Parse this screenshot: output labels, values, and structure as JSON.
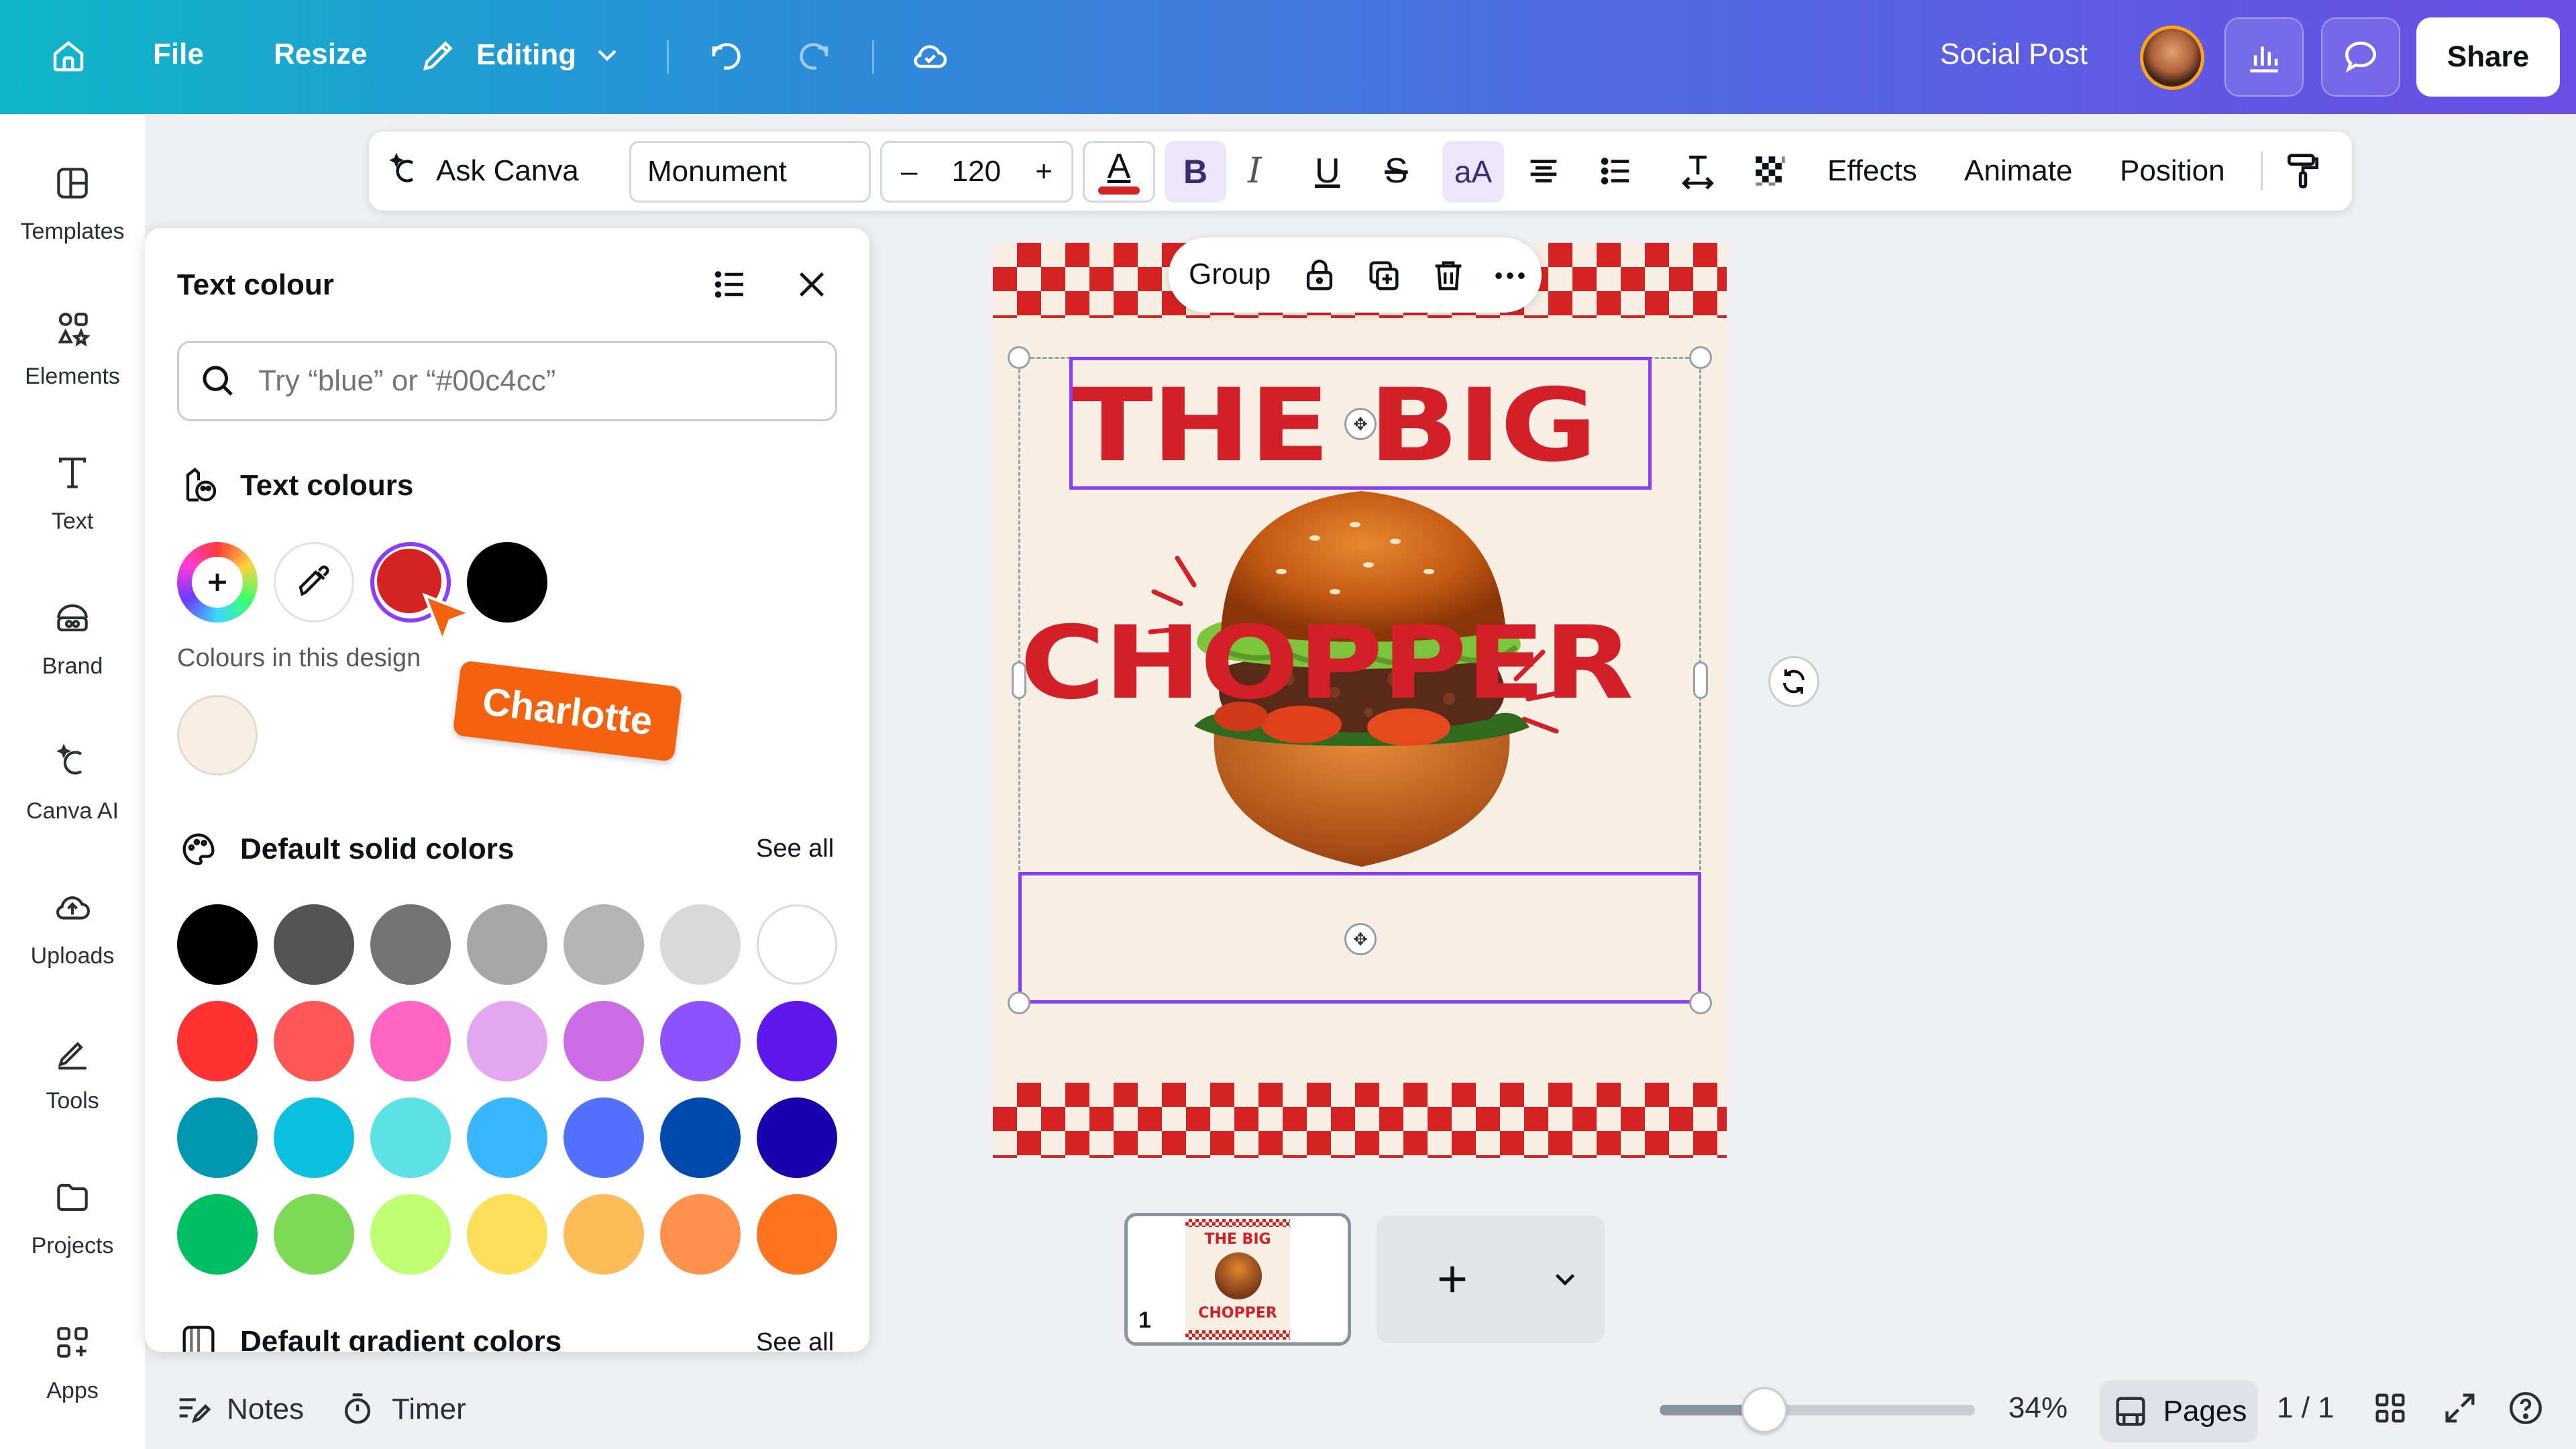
{
  "topbar": {
    "file_label": "File",
    "resize_label": "Resize",
    "editing_label": "Editing",
    "doc_title": "Social Post",
    "share_label": "Share"
  },
  "rail": {
    "items": [
      {
        "label": "Templates",
        "icon": "templates-icon"
      },
      {
        "label": "Elements",
        "icon": "elements-icon"
      },
      {
        "label": "Text",
        "icon": "text-icon"
      },
      {
        "label": "Brand",
        "icon": "brand-icon"
      },
      {
        "label": "Canva AI",
        "icon": "canva-ai-icon"
      },
      {
        "label": "Uploads",
        "icon": "uploads-icon"
      },
      {
        "label": "Tools",
        "icon": "tools-icon"
      },
      {
        "label": "Projects",
        "icon": "projects-icon"
      },
      {
        "label": "Apps",
        "icon": "apps-icon"
      }
    ]
  },
  "panel": {
    "title": "Text colour",
    "search_placeholder": "Try “blue” or “#00c4cc”",
    "text_colours_title": "Text colours",
    "design_colours_label": "Colours in this design",
    "default_solid_title": "Default solid colors",
    "default_gradient_title": "Default gradient colors",
    "see_all_label": "See all",
    "text_colours": [
      "#d52323",
      "#000000"
    ],
    "design_colours": [
      "#f8efe4"
    ],
    "solid_colors": [
      [
        "#000000",
        "#545454",
        "#737373",
        "#a6a6a6",
        "#b4b4b4",
        "#d9d9d9",
        "#ffffff"
      ],
      [
        "#ff3131",
        "#ff5757",
        "#ff66c4",
        "#e4a6f0",
        "#cb6ce6",
        "#8c52ff",
        "#5e17eb"
      ],
      [
        "#0097b2",
        "#0cc0df",
        "#5ce1e6",
        "#38b6ff",
        "#5271ff",
        "#004aad",
        "#1800ad"
      ],
      [
        "#00bf63",
        "#7ed957",
        "#c1ff72",
        "#ffde59",
        "#ffbd59",
        "#ff914d",
        "#ff751f"
      ]
    ]
  },
  "collaborator": {
    "name": "Charlotte",
    "color": "#f5620f"
  },
  "toolbar": {
    "ask_canva": "Ask Canva",
    "font_name": "Monument",
    "font_size": "120",
    "minus": "–",
    "plus": "+",
    "bold": "B",
    "italic": "I",
    "underline": "U",
    "strike": "S",
    "case": "aA",
    "effects": "Effects",
    "animate": "Animate",
    "position": "Position",
    "text_color": "#d52323"
  },
  "context_menu": {
    "group_label": "Group"
  },
  "design": {
    "headline_top": "THE BIG",
    "headline_bottom": "CHOPPER",
    "text_color": "#d31f27",
    "background": "#f8efe4"
  },
  "pages": {
    "thumb_number": "1",
    "thumb_top": "THE BIG",
    "thumb_bottom": "CHOPPER"
  },
  "bottombar": {
    "notes": "Notes",
    "timer": "Timer",
    "zoom": "34%",
    "pages_label": "Pages",
    "page_count": "1 / 1",
    "zoom_level": 0.34
  },
  "accent": "#8b3dff"
}
